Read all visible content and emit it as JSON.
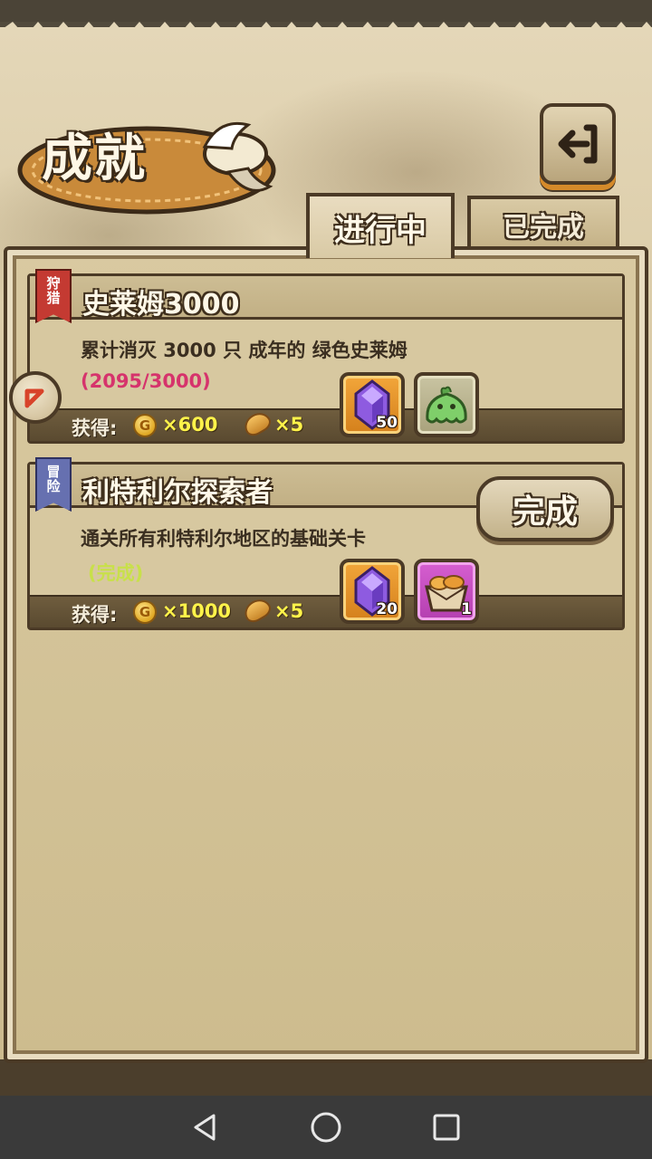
{
  "title": "成就",
  "tabs": [
    {
      "label": "进行中",
      "active": true
    },
    {
      "label": "已完成",
      "active": false
    }
  ],
  "achievements": [
    {
      "tag": [
        "狩",
        "猎"
      ],
      "title": "史莱姆3000",
      "description": "累计消灭 3000 只 成年的 绿色史莱姆",
      "progress": "(2095/3000)",
      "progress_color": "#d6336c",
      "reward_label": "获得:",
      "coin_symbol": "G",
      "coins": "×600",
      "bread": "×5",
      "items": [
        {
          "icon": "purple-gem-icon",
          "count": "50",
          "frame": "gold"
        },
        {
          "icon": "green-slime-icon",
          "count": "",
          "frame": "green"
        }
      ]
    },
    {
      "tag": [
        "冒",
        "险"
      ],
      "title": "利特利尔探索者",
      "description": "通关所有利特利尔地区的基础关卡",
      "progress": "(完成)",
      "progress_color": "#c8e04a",
      "reward_label": "获得:",
      "coin_symbol": "G",
      "coins": "×1000",
      "bread": "×5",
      "items": [
        {
          "icon": "purple-gem-icon",
          "count": "20",
          "frame": "gold"
        },
        {
          "icon": "bread-basket-icon",
          "count": "1",
          "frame": "pink"
        }
      ],
      "button_label": "完成"
    }
  ]
}
